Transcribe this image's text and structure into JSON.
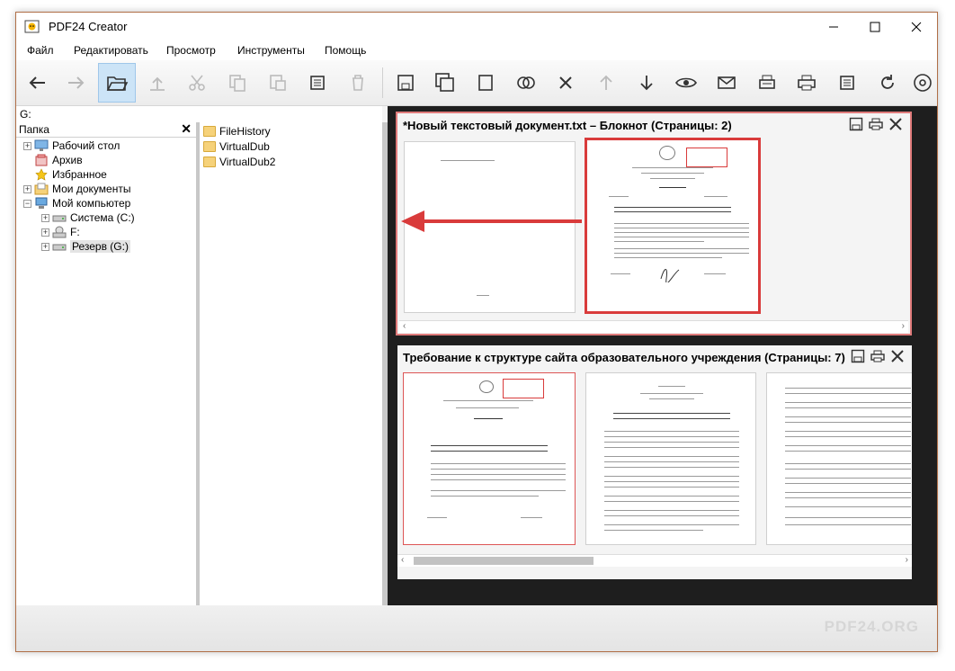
{
  "window": {
    "title": "PDF24 Creator",
    "minimize_icon": "minimize-icon",
    "maximize_icon": "maximize-icon",
    "close_icon": "close-icon"
  },
  "menu": [
    "Файл",
    "Редактировать",
    "Просмотр",
    "Инструменты",
    "Помощь"
  ],
  "toolbar": {
    "buttons": [
      "back-arrow-icon",
      "forward-arrow-icon",
      "open-folder-icon",
      "upload-icon",
      "cut-icon",
      "copy-icon",
      "paste-icon",
      "select-all-icon",
      "delete-icon",
      "save-icon",
      "save-as-icon",
      "blank-page-icon",
      "merge-icon",
      "remove-icon",
      "move-up-icon",
      "move-down-icon",
      "preview-icon",
      "email-icon",
      "fax-icon",
      "print-icon",
      "properties-icon",
      "rotate-icon",
      "at-icon"
    ]
  },
  "path": "G:",
  "folder_pane": {
    "header": "Папка",
    "close": "✕",
    "tree": [
      {
        "label": "Рабочий стол",
        "icon": "desktop-icon"
      },
      {
        "label": "Архив",
        "icon": "archive-icon"
      },
      {
        "label": "Избранное",
        "icon": "star-icon"
      },
      {
        "label": "Мои документы",
        "icon": "documents-icon"
      },
      {
        "label": "Мой компьютер",
        "icon": "computer-icon"
      },
      {
        "label": "Система (C:)",
        "icon": "drive-icon"
      },
      {
        "label": "F:",
        "icon": "cd-drive-icon"
      },
      {
        "label": "Резерв (G:)",
        "icon": "drive-icon"
      }
    ]
  },
  "file_list": [
    "FileHistory",
    "VirtualDub",
    "VirtualDub2"
  ],
  "documents": [
    {
      "title": "*Новый текстовый документ.txt – Блокнот (Страницы: 2)"
    },
    {
      "title": "Требование к структуре сайта образовательного учреждения (Страницы: 7)"
    }
  ],
  "brand": "PDF24.ORG",
  "colors": {
    "highlight": "#d93b3b",
    "selection": "#cce4f7"
  }
}
